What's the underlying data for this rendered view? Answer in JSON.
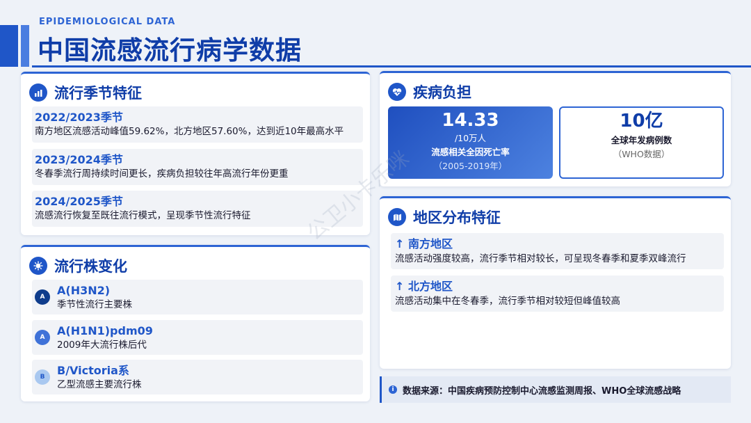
{
  "header": {
    "subtitle": "EPIDEMIOLOGICAL DATA",
    "title": "中国流感流行病学数据"
  },
  "season": {
    "title": "流行季节特征",
    "icon": "chart-icon",
    "items": [
      {
        "label": "2022/2023季节",
        "text": "南方地区流感活动峰值59.62%，北方地区57.60%，达到近10年最高水平"
      },
      {
        "label": "2023/2024季节",
        "text": "冬春季流行周持续时间更长，疾病负担较往年高流行年份更重"
      },
      {
        "label": "2024/2025季节",
        "text": "流感流行恢复至既往流行模式，呈现季节性流行特征"
      }
    ]
  },
  "strains": {
    "title": "流行株变化",
    "icon": "virus-icon",
    "items": [
      {
        "badge": "A",
        "name": "A(H3N2)",
        "desc": "季节性流行主要株",
        "color": "#0f3d8c"
      },
      {
        "badge": "A",
        "name": "A(H1N1)pdm09",
        "desc": "2009年大流行株后代",
        "color": "#3f72d8"
      },
      {
        "badge": "B",
        "name": "B/Victoria系",
        "desc": "乙型流感主要流行株",
        "color": "#9cc0ee"
      }
    ]
  },
  "burden": {
    "title": "疾病负担",
    "icon": "heart-pulse-icon",
    "stat1": {
      "value": "14.33",
      "unit": "/10万人",
      "label": "流感相关全因死亡率",
      "note": "（2005-2019年）"
    },
    "stat2": {
      "value": "10亿",
      "label": "全球年发病例数",
      "note": "（WHO数据）"
    }
  },
  "region": {
    "title": "地区分布特征",
    "icon": "map-icon",
    "items": [
      {
        "arrow": "↑",
        "label": "南方地区",
        "text": "流感活动强度较高，流行季节相对较长，可呈现冬春季和夏季双峰流行"
      },
      {
        "arrow": "↑",
        "label": "北方地区",
        "text": "流感活动集中在冬春季，流行季节相对较短但峰值较高"
      }
    ]
  },
  "source": {
    "icon": "info-icon",
    "text": "数据来源：中国疾病预防控制中心流感监测周报、WHO全球流感战略"
  },
  "watermark": "公卫小卡乐咪"
}
